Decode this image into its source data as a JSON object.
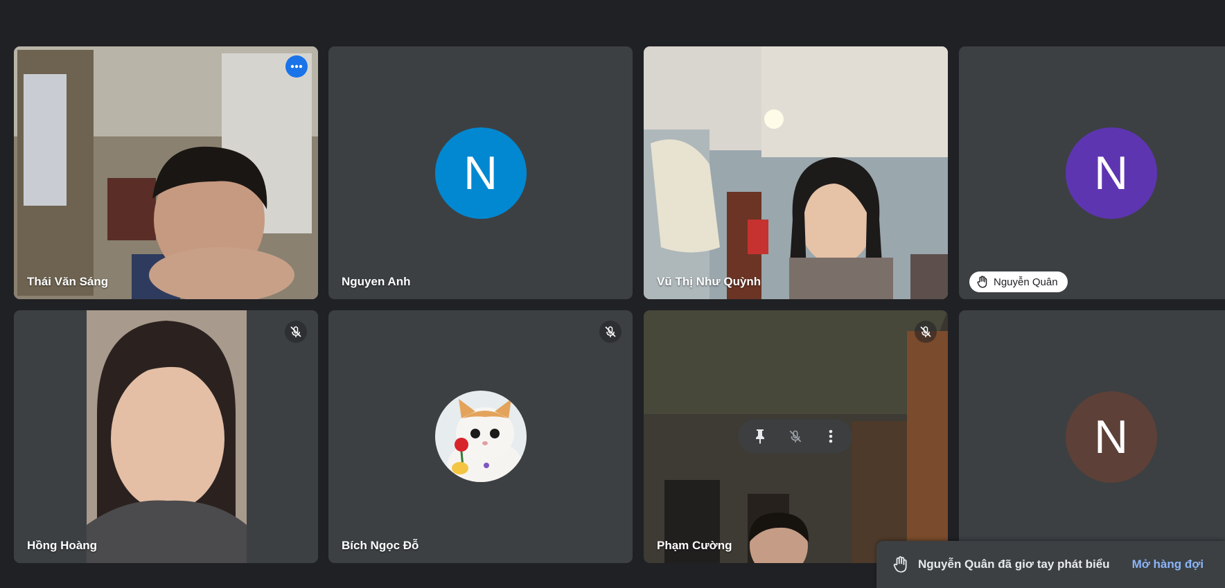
{
  "participants": [
    {
      "name": "Thái Văn Sáng",
      "type": "video",
      "active": true
    },
    {
      "name": "Nguyen Anh",
      "type": "avatar",
      "initial": "N",
      "avatar_color": "#0288d1"
    },
    {
      "name": "Vũ Thị Như Quỳnh",
      "type": "video"
    },
    {
      "name": "Nguyễn Quân",
      "type": "avatar",
      "initial": "N",
      "avatar_color": "#5e35b1",
      "hand_raised": true
    },
    {
      "name": "Hồng Hoàng",
      "type": "video",
      "muted": true
    },
    {
      "name": "Bích Ngọc Đỗ",
      "type": "photo-avatar",
      "muted": true
    },
    {
      "name": "Phạm Cường",
      "type": "video",
      "muted": true
    },
    {
      "name": "",
      "type": "avatar",
      "initial": "N",
      "avatar_color": "#5d4037"
    }
  ],
  "notification": {
    "text": "Nguyễn Quân đã giơ tay phát biểu",
    "action_label": "Mở hàng đợi"
  },
  "icons": {
    "more": "more-horiz-icon",
    "mic_off": "mic-off-icon",
    "pin": "pin-icon",
    "hand": "raised-hand-icon",
    "more_vert": "more-vert-icon"
  },
  "colors": {
    "background": "#202124",
    "tile": "#3c4043",
    "active_border": "#8ab4f8",
    "link": "#8ab4f8"
  }
}
